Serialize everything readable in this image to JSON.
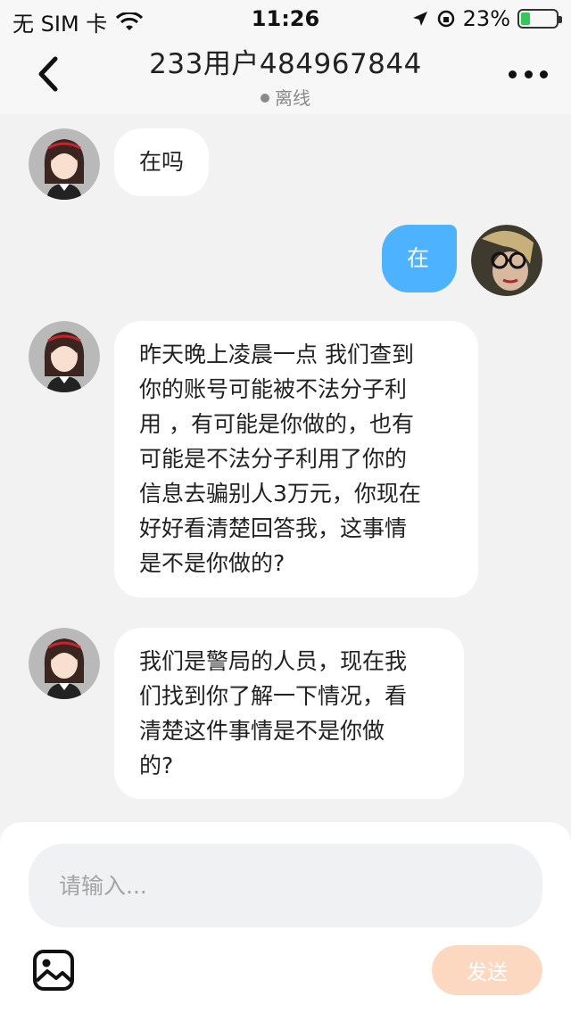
{
  "status_bar": {
    "carrier": "无 SIM 卡",
    "time": "11:26",
    "battery": "23%"
  },
  "header": {
    "title": "233用户484967844",
    "status": "离线"
  },
  "messages": [
    {
      "from": "other",
      "text": "在吗"
    },
    {
      "from": "self",
      "text": "在"
    },
    {
      "from": "other",
      "lines": [
        "昨天晚上凌晨一点 我们查到",
        "你的账号可能被不法分子利",
        "用 ，有可能是你做的，也有",
        "可能是不法分子利用了你的",
        "信息去骗别人3万元，你现在",
        "好好看清楚回答我，这事情",
        "是不是你做的?"
      ]
    },
    {
      "from": "other",
      "lines": [
        "我们是警局的人员，现在我",
        "们找到你了解一下情况，看",
        "清楚这件事情是不是你做",
        "的?"
      ]
    }
  ],
  "input": {
    "placeholder": "请输入...",
    "value": ""
  },
  "send_label": "发送",
  "colors": {
    "self_bubble": "#4db2ff",
    "send_button_disabled": "#fcd8c1",
    "background": "#f2f2f2"
  },
  "icons": [
    "wifi-icon",
    "location-arrow-icon",
    "orientation-lock-icon",
    "battery-icon",
    "back-chevron-icon",
    "more-dots-icon",
    "image-icon"
  ]
}
